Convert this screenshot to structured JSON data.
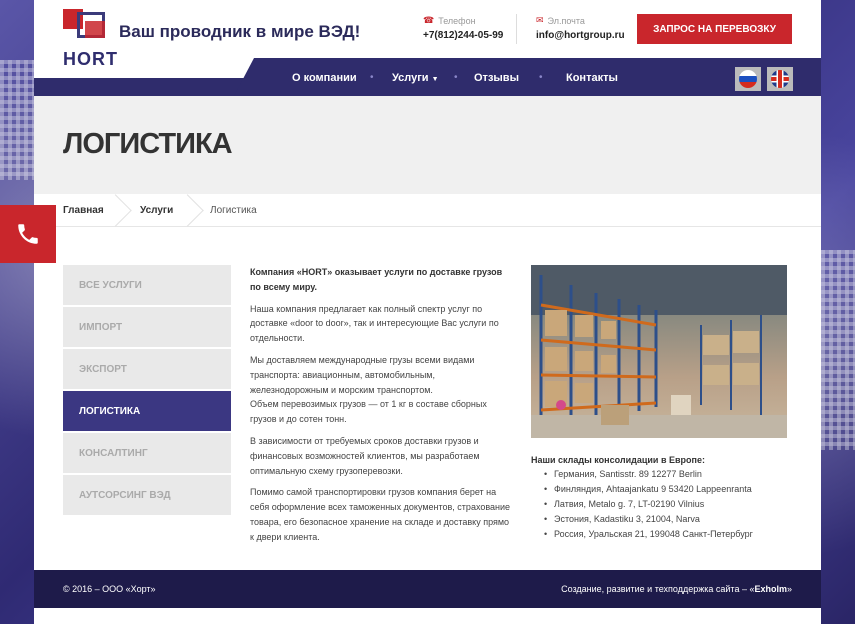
{
  "header": {
    "logo_text": "HORT",
    "tagline": "Ваш проводник в мире ВЭД!",
    "phone_label": "Телефон",
    "phone_value": "+7(812)244-05-99",
    "email_label": "Эл.почта",
    "email_value": "info@hortgroup.ru",
    "request_button": "ЗАПРОС НА ПЕРЕВОЗКУ"
  },
  "nav": {
    "items": [
      {
        "label": "О компании"
      },
      {
        "label": "Услуги",
        "has_dropdown": true
      },
      {
        "label": "Отзывы"
      },
      {
        "label": "Контакты"
      }
    ],
    "languages": [
      "ru",
      "en"
    ]
  },
  "page_title": "ЛОГИСТИКА",
  "breadcrumb": [
    "Главная",
    "Услуги",
    "Логистика"
  ],
  "sidebar": {
    "items": [
      {
        "label": "ВСЕ УСЛУГИ",
        "active": false
      },
      {
        "label": "ИМПОРТ",
        "active": false
      },
      {
        "label": "ЭКСПОРТ",
        "active": false
      },
      {
        "label": "ЛОГИСТИКА",
        "active": true
      },
      {
        "label": "КОНСАЛТИНГ",
        "active": false
      },
      {
        "label": "АУТСОРСИНГ ВЭД",
        "active": false
      }
    ]
  },
  "content": {
    "lead": "Компания «HORT» оказывает услуги по доставке грузов по всему миру.",
    "p1": "Наша компания предлагает как полный спектр услуг по доставке «door to door», так и интересующие Вас услуги по отдельности.",
    "p2a": "Мы доставляем международные грузы всеми видами транспорта: авиационным, автомобильным, железнодорожным и морским транспортом.",
    "p2b": "Объем перевозимых грузов — от 1 кг в составе сборных грузов и до сотен тонн.",
    "p3": "В зависимости от требуемых сроков доставки грузов и финансовых возможностей клиентов, мы разработаем оптимальную схему грузоперевозки.",
    "p4": "Помимо самой транспортировки грузов компания берет на себя оформление всех таможенных документов, страхование товара, его безопасное хранение на складе и доставку прямо к двери клиента."
  },
  "warehouses": {
    "title": "Наши склады консолидации в Европе:",
    "items": [
      "Германия, Santisstr. 89 12277 Berlin",
      "Финляндия, Ahtaajankatu 9 53420 Lappeenranta",
      "Латвия, Metalo g. 7, LT-02190 Vilnius",
      "Эстония, Kadastiku 3, 21004, Narva",
      "Россия, Уральская 21, 199048 Санкт-Петербург"
    ]
  },
  "footer": {
    "copyright": "© 2016 – ООО «Хорт»",
    "credit_prefix": "Создание, развитие и техподдержка сайта – «",
    "credit_name": "Exholm",
    "credit_suffix": "»"
  },
  "colors": {
    "accent_red": "#c9262c",
    "nav_dark": "#2f2c6c",
    "sidebar_active": "#3b3782",
    "footer": "#1e1b4a"
  }
}
